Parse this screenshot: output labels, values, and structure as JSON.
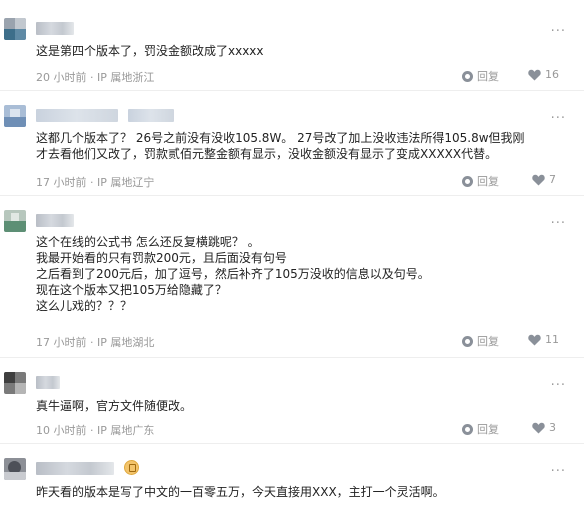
{
  "more_label": "···",
  "reply_label": "回复",
  "comments": [
    {
      "text": [
        "这是第四个版本了，罚没金额改成了xxxxx"
      ],
      "time": "20 小时前",
      "location": "IP 属地浙江",
      "likes": "16"
    },
    {
      "text": [
        "这都几个版本了？ 26号之前没有没收105.8W。 27号改了加上没收违法所得105.8w但我刚",
        "才去看他们又改了，罚款贰佰元整金额有显示，没收金额没有显示了变成XXXXX代替。"
      ],
      "time": "17 小时前",
      "location": "IP 属地辽宁",
      "likes": "7"
    },
    {
      "text": [
        "这个在线的公式书 怎么还反复横跳呢？ 。",
        "我最开始看的只有罚款200元，且后面没有句号",
        "之后看到了200元后，加了逗号，然后补齐了105万没收的信息以及句号。",
        "现在这个版本又把105万给隐藏了？",
        "这么儿戏的？？？"
      ],
      "time": "17 小时前",
      "location": "IP 属地湖北",
      "likes": "11"
    },
    {
      "text": [
        "真牛逼啊，官方文件随便改。"
      ],
      "time": "10 小时前",
      "location": "IP 属地广东",
      "likes": "3"
    },
    {
      "text": [
        "昨天看的版本是写了中文的一百零五万，今天直接用XXX，主打一个灵活啊。"
      ]
    }
  ]
}
